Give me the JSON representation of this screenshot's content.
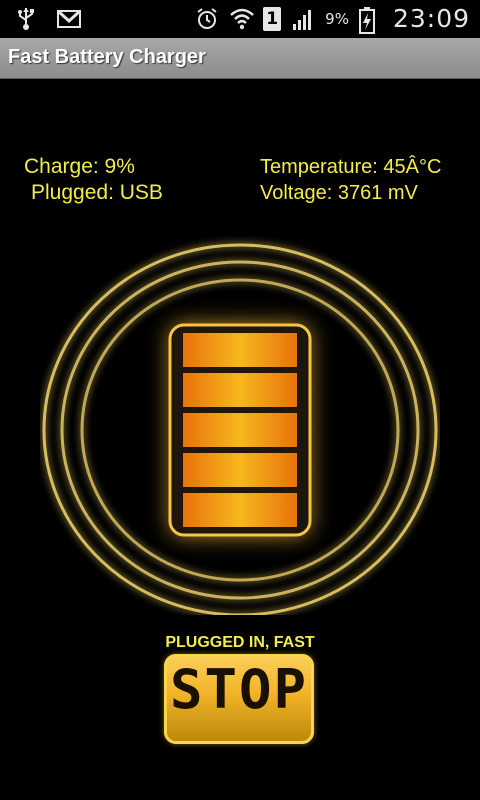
{
  "status_bar": {
    "icons_left": [
      "usb-icon",
      "gmail-icon"
    ],
    "icons_right": [
      "alarm-icon",
      "wifi-icon",
      "sim-icon",
      "signal-icon",
      "battery-charging-icon"
    ],
    "sim_label": "1",
    "battery_percent": "9%",
    "time": "23:09"
  },
  "app": {
    "title": "Fast Battery Charger"
  },
  "info": {
    "charge": "Charge: 9%",
    "plugged": "Plugged: USB",
    "temperature": "Temperature: 45Â°C",
    "voltage": "Voltage: 3761 mV"
  },
  "battery_graphic": {
    "segments": 5,
    "accent": "#f2a51c",
    "glow": "#f5c542"
  },
  "charge_state": "PLUGGED IN, FAST",
  "stop_button": {
    "label": "STOP"
  }
}
